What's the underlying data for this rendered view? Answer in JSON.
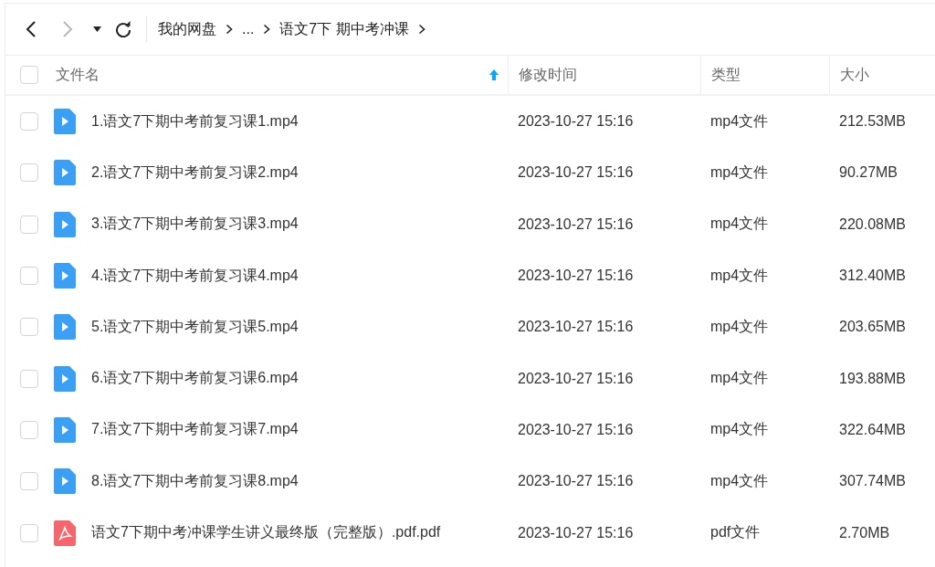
{
  "toolbar": {
    "back_disabled": false,
    "forward_disabled": true,
    "breadcrumb": [
      {
        "label": "我的网盘"
      },
      {
        "label": "..."
      },
      {
        "label": "语文7下 期中考冲课"
      }
    ]
  },
  "table": {
    "all_checked": false,
    "columns": [
      {
        "label": "文件名",
        "sorted": true
      },
      {
        "label": "修改时间",
        "sorted": false
      },
      {
        "label": "类型",
        "sorted": false
      },
      {
        "label": "大小",
        "sorted": false
      }
    ],
    "rows": [
      {
        "kind": "video",
        "checked": false,
        "name": "1.语文7下期中考前复习课1.mp4",
        "modified": "2023-10-27 15:16",
        "type": "mp4文件",
        "size": "212.53MB"
      },
      {
        "kind": "video",
        "checked": false,
        "name": "2.语文7下期中考前复习课2.mp4",
        "modified": "2023-10-27 15:16",
        "type": "mp4文件",
        "size": "90.27MB"
      },
      {
        "kind": "video",
        "checked": false,
        "name": "3.语文7下期中考前复习课3.mp4",
        "modified": "2023-10-27 15:16",
        "type": "mp4文件",
        "size": "220.08MB"
      },
      {
        "kind": "video",
        "checked": false,
        "name": "4.语文7下期中考前复习课4.mp4",
        "modified": "2023-10-27 15:16",
        "type": "mp4文件",
        "size": "312.40MB"
      },
      {
        "kind": "video",
        "checked": false,
        "name": "5.语文7下期中考前复习课5.mp4",
        "modified": "2023-10-27 15:16",
        "type": "mp4文件",
        "size": "203.65MB"
      },
      {
        "kind": "video",
        "checked": false,
        "name": "6.语文7下期中考前复习课6.mp4",
        "modified": "2023-10-27 15:16",
        "type": "mp4文件",
        "size": "193.88MB"
      },
      {
        "kind": "video",
        "checked": false,
        "name": "7.语文7下期中考前复习课7.mp4",
        "modified": "2023-10-27 15:16",
        "type": "mp4文件",
        "size": "322.64MB"
      },
      {
        "kind": "video",
        "checked": false,
        "name": "8.语文7下期中考前复习课8.mp4",
        "modified": "2023-10-27 15:16",
        "type": "mp4文件",
        "size": "307.74MB"
      },
      {
        "kind": "pdf",
        "checked": false,
        "name": "语文7下期中考冲课学生讲义最终版（完整版）.pdf.pdf",
        "modified": "2023-10-27 15:16",
        "type": "pdf文件",
        "size": "2.70MB"
      }
    ]
  }
}
